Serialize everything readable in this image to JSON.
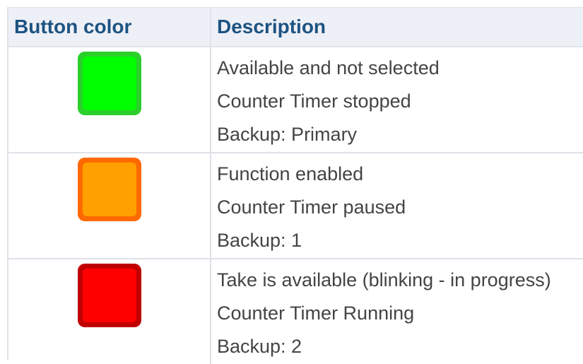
{
  "header": {
    "col_color": "Button color",
    "col_description": "Description"
  },
  "rows": [
    {
      "color": "#00ff00",
      "icon": "green-square",
      "lines": [
        "Available and not selected",
        "Counter Timer stopped",
        "Backup: Primary"
      ]
    },
    {
      "color": "#ffa000",
      "icon": "orange-square",
      "lines": [
        "Function enabled",
        "Counter Timer paused",
        "Backup: 1"
      ]
    },
    {
      "color": "#ff0000",
      "icon": "red-square",
      "lines": [
        "Take is available (blinking - in progress)",
        "Counter Timer Running",
        "Backup: 2"
      ]
    }
  ]
}
